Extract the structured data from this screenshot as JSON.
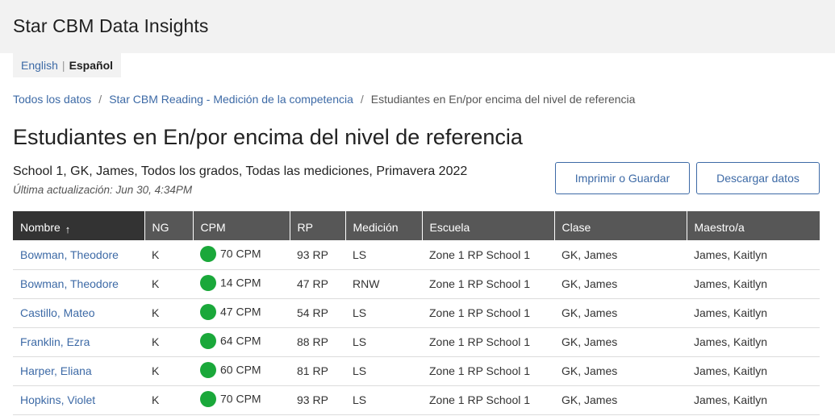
{
  "app": {
    "title": "Star CBM Data Insights"
  },
  "language": {
    "english": "English",
    "separator": "|",
    "spanish": "Español"
  },
  "breadcrumb": {
    "items": [
      "Todos los datos",
      "Star CBM Reading - Medición de la competencia"
    ],
    "separator": "/",
    "current": "Estudiantes en En/por encima del nivel de referencia"
  },
  "page": {
    "title": "Estudiantes en En/por encima del nivel de referencia",
    "subtitle": "School 1, GK, James, Todos los grados, Todas las mediciones, Primavera 2022",
    "updated": "Última actualización: Jun 30, 4:34PM"
  },
  "actions": {
    "print": "Imprimir o Guardar",
    "download": "Descargar datos"
  },
  "table": {
    "headers": [
      "Nombre",
      "NG",
      "CPM",
      "RP",
      "Medición",
      "Escuela",
      "Clase",
      "Maestro/a"
    ],
    "sort_icon": "arrow-up-icon",
    "status_color": "#1aa83a",
    "rows": [
      {
        "name": "Bowman, Theodore",
        "ng": "K",
        "cpm": "70 CPM",
        "rp": "93 RP",
        "med": "LS",
        "school": "Zone 1 RP School 1",
        "class": "GK, James",
        "teacher": "James, Kaitlyn"
      },
      {
        "name": "Bowman, Theodore",
        "ng": "K",
        "cpm": "14 CPM",
        "rp": "47 RP",
        "med": "RNW",
        "school": "Zone 1 RP School 1",
        "class": "GK, James",
        "teacher": "James, Kaitlyn"
      },
      {
        "name": "Castillo, Mateo",
        "ng": "K",
        "cpm": "47 CPM",
        "rp": "54 RP",
        "med": "LS",
        "school": "Zone 1 RP School 1",
        "class": "GK, James",
        "teacher": "James, Kaitlyn"
      },
      {
        "name": "Franklin, Ezra",
        "ng": "K",
        "cpm": "64 CPM",
        "rp": "88 RP",
        "med": "LS",
        "school": "Zone 1 RP School 1",
        "class": "GK, James",
        "teacher": "James, Kaitlyn"
      },
      {
        "name": "Harper, Eliana",
        "ng": "K",
        "cpm": "60 CPM",
        "rp": "81 RP",
        "med": "LS",
        "school": "Zone 1 RP School 1",
        "class": "GK, James",
        "teacher": "James, Kaitlyn"
      },
      {
        "name": "Hopkins, Violet",
        "ng": "K",
        "cpm": "70 CPM",
        "rp": "93 RP",
        "med": "LS",
        "school": "Zone 1 RP School 1",
        "class": "GK, James",
        "teacher": "James, Kaitlyn"
      }
    ]
  }
}
